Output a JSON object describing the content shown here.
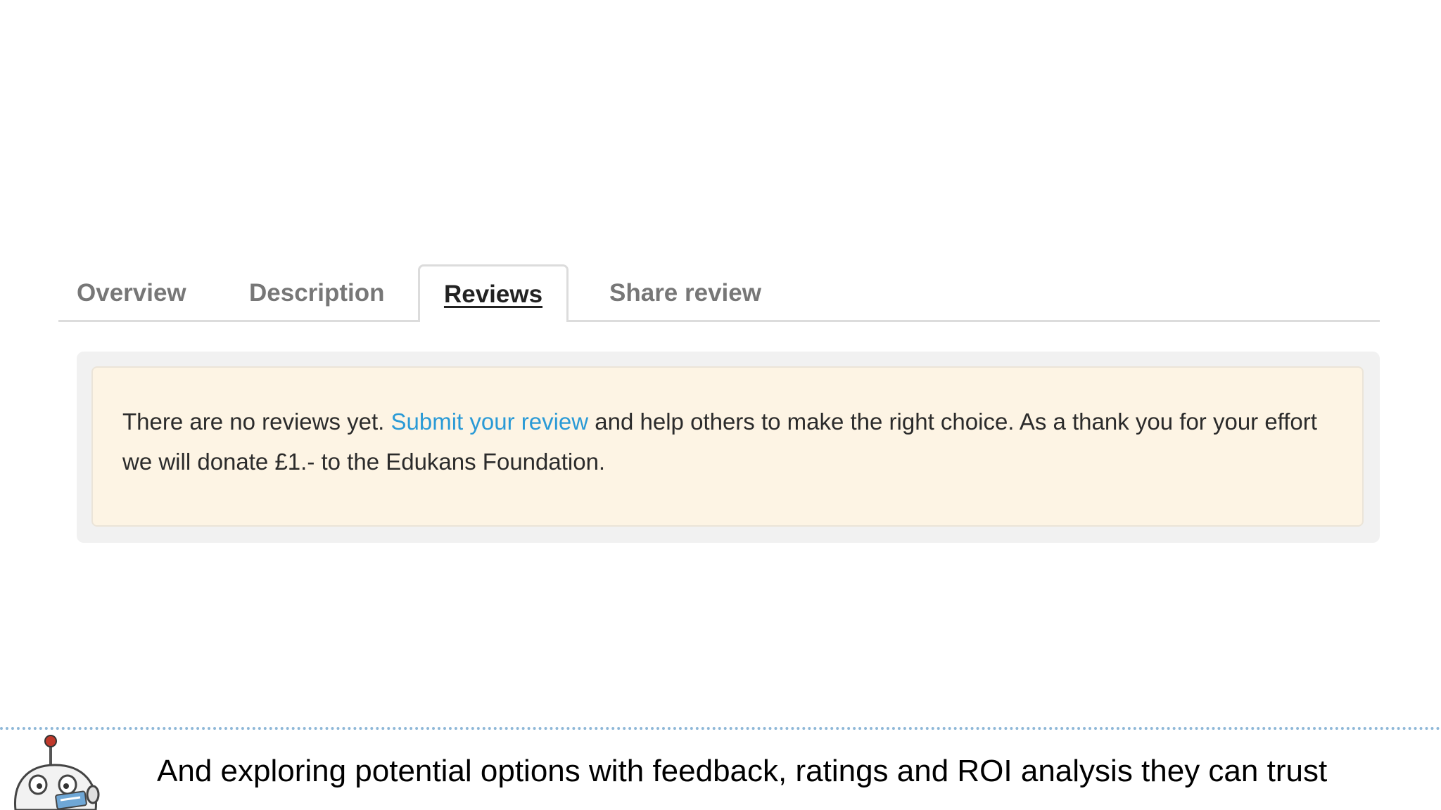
{
  "tabs": {
    "overview": "Overview",
    "description": "Description",
    "reviews": "Reviews",
    "share_review": "Share review"
  },
  "reviews_notice": {
    "text_before": "There are no reviews yet. ",
    "link_text": "Submit your review",
    "text_after": " and help others to make the right choice. As a thank you for your effort we will donate £1.- to the Edukans Foundation."
  },
  "caption": "And exploring potential options with feedback, ratings and ROI analysis they can trust",
  "colors": {
    "link": "#2a9ad6",
    "notice_background": "#fdf4e4",
    "panel_background": "#f1f1f1",
    "divider": "#8fb8d8"
  },
  "icons": {
    "mascot": "robot-mascot-icon"
  }
}
